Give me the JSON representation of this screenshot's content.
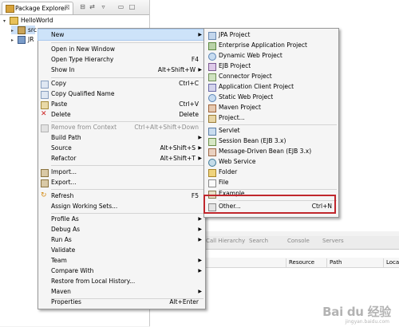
{
  "explorer": {
    "tab_label": "Package Explorer",
    "tab_close": "☒",
    "tree": [
      {
        "label": "HelloWorld"
      },
      {
        "label": "src"
      },
      {
        "label": "JR"
      }
    ]
  },
  "context_menu": {
    "items": [
      {
        "label": "New",
        "submenu": true
      },
      {
        "label": "Open in New Window"
      },
      {
        "label": "Open Type Hierarchy",
        "accel": "F4"
      },
      {
        "label": "Show In",
        "accel": "Alt+Shift+W",
        "submenu": true
      },
      {
        "label": "Copy",
        "accel": "Ctrl+C"
      },
      {
        "label": "Copy Qualified Name"
      },
      {
        "label": "Paste",
        "accel": "Ctrl+V"
      },
      {
        "label": "Delete",
        "accel": "Delete"
      },
      {
        "label": "Remove from Context",
        "accel": "Ctrl+Alt+Shift+Down",
        "disabled": true
      },
      {
        "label": "Build Path",
        "submenu": true
      },
      {
        "label": "Source",
        "accel": "Alt+Shift+S",
        "submenu": true
      },
      {
        "label": "Refactor",
        "accel": "Alt+Shift+T",
        "submenu": true
      },
      {
        "label": "Import..."
      },
      {
        "label": "Export..."
      },
      {
        "label": "Refresh",
        "accel": "F5"
      },
      {
        "label": "Assign Working Sets..."
      },
      {
        "label": "Profile As",
        "submenu": true
      },
      {
        "label": "Debug As",
        "submenu": true
      },
      {
        "label": "Run As",
        "submenu": true
      },
      {
        "label": "Validate"
      },
      {
        "label": "Team",
        "submenu": true
      },
      {
        "label": "Compare With",
        "submenu": true
      },
      {
        "label": "Restore from Local History..."
      },
      {
        "label": "Maven",
        "submenu": true
      },
      {
        "label": "Properties",
        "accel": "Alt+Enter"
      }
    ]
  },
  "new_submenu": {
    "items": [
      {
        "label": "JPA Project"
      },
      {
        "label": "Enterprise Application Project"
      },
      {
        "label": "Dynamic Web Project"
      },
      {
        "label": "EJB Project"
      },
      {
        "label": "Connector Project"
      },
      {
        "label": "Application Client Project"
      },
      {
        "label": "Static Web Project"
      },
      {
        "label": "Maven Project"
      },
      {
        "label": "Project..."
      },
      {
        "label": "Servlet"
      },
      {
        "label": "Session Bean (EJB 3.x)"
      },
      {
        "label": "Message-Driven Bean (EJB 3.x)"
      },
      {
        "label": "Web Service"
      },
      {
        "label": "Folder"
      },
      {
        "label": "File"
      },
      {
        "label": "Example..."
      },
      {
        "label": "Other...",
        "accel": "Ctrl+N"
      }
    ]
  },
  "bottom_panel": {
    "tabs": [
      "Call Hierarchy",
      "Search",
      "Console",
      "Servers"
    ],
    "columns": [
      "Resource",
      "Path",
      "Locati"
    ]
  },
  "watermark": {
    "text": "Bai du 经验",
    "sub": "jingyan.baidu.com"
  },
  "colors": {
    "highlight": "#cde3f9",
    "callout": "#c0272d"
  }
}
